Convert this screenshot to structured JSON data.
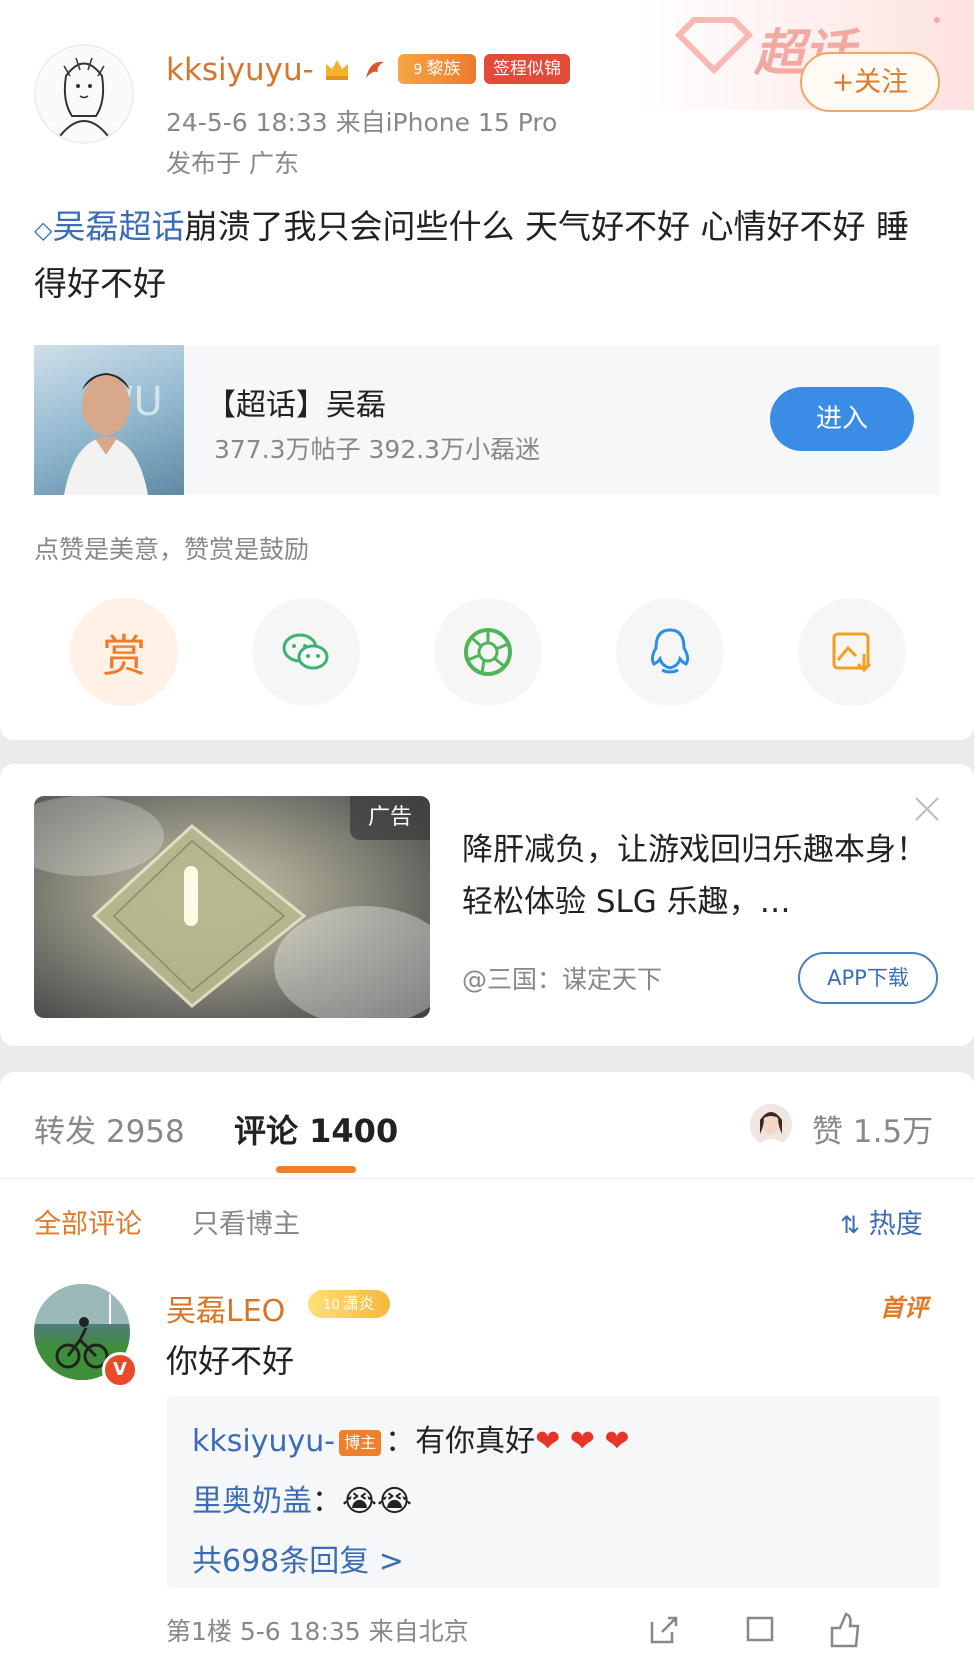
{
  "post": {
    "username": "kksiyuyu-",
    "badge_level": "黎族",
    "badge_level_num": "9",
    "badge_signin": "签程似锦",
    "time_source": "24-5-6 18:33  来自iPhone 15 Pro",
    "location": "发布于 广东",
    "follow_label": "+关注",
    "supertopic_deco": "超话",
    "topic_link": "吴磊超话",
    "text": "崩溃了我只会问些什么 天气好不好 心情好不好 睡得好不好"
  },
  "topic_card": {
    "title": "【超话】吴磊",
    "stats": "377.3万帖子 392.3万小磊迷",
    "enter_label": "进入"
  },
  "reward_hint": "点赞是美意，赞赏是鼓励",
  "share": {
    "reward_label": "赏",
    "buttons": [
      "reward-icon",
      "wechat-icon",
      "moments-icon",
      "qq-icon",
      "save-image-icon"
    ]
  },
  "ad": {
    "label": "广告",
    "title": "降肝减负，让游戏回归乐趣本身！轻松体验 SLG 乐趣，…",
    "advertiser": "@三国：谋定天下",
    "download_label": "APP下载"
  },
  "tabs": {
    "repost": "转发 2958",
    "comment": "评论 1400",
    "like": "赞 1.5万"
  },
  "filters": {
    "all": "全部评论",
    "author_only": "只看博主",
    "sort": "热度"
  },
  "comment": {
    "name": "吴磊LEO",
    "badge": "潇炎",
    "badge_num": "10",
    "first_label": "首评",
    "text": "你好不好",
    "replies": [
      {
        "user": "kksiyuyu-",
        "tag": "博主",
        "text": "：有你真好",
        "emoji": "❤ ❤ ❤"
      },
      {
        "user": "里奥奶盖",
        "text": "：",
        "emoji": "😭😭"
      }
    ],
    "more_replies": "共698条回复 >",
    "footer": "第1楼  5-6 18:35  来自北京"
  },
  "colors": {
    "accent_orange": "#e07a2a",
    "link_blue": "#3b6db6",
    "enter_blue": "#3a8ce4"
  }
}
